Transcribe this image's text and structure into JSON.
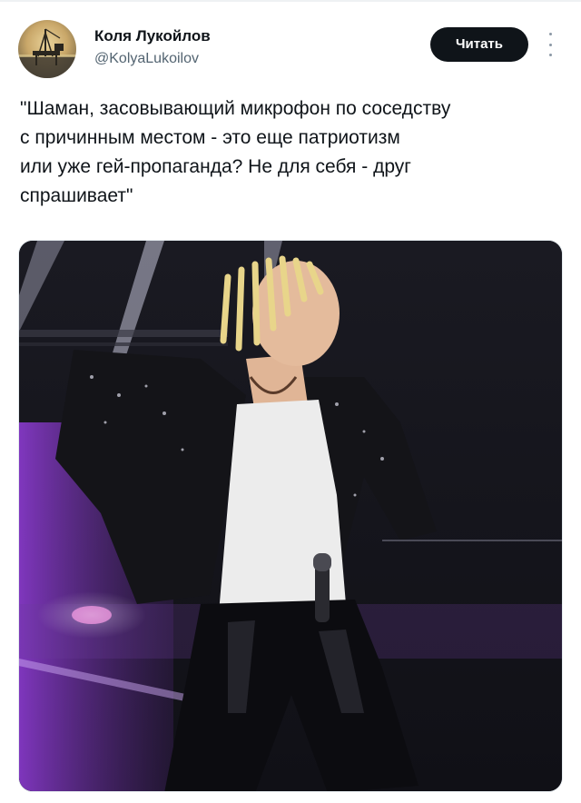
{
  "author": {
    "display_name": "Коля Лукойлов",
    "handle": "@KolyaLukoilov",
    "avatar_icon": "oil-rig-avatar"
  },
  "actions": {
    "follow_label": "Читать",
    "more_icon": "more-vertical-icon"
  },
  "tweet": {
    "text": "\"Шаман, засовывающий микрофон по соседству\nс причинным местом - это еще патриотизм\nили уже гей-пропаганда? Не для себя - друг\nспрашивает\""
  },
  "media": {
    "type": "photo",
    "colors": {
      "stage_purple": "#8a3bd6",
      "spotlight": "#e8e8ff",
      "background": "#0f0f14"
    }
  }
}
